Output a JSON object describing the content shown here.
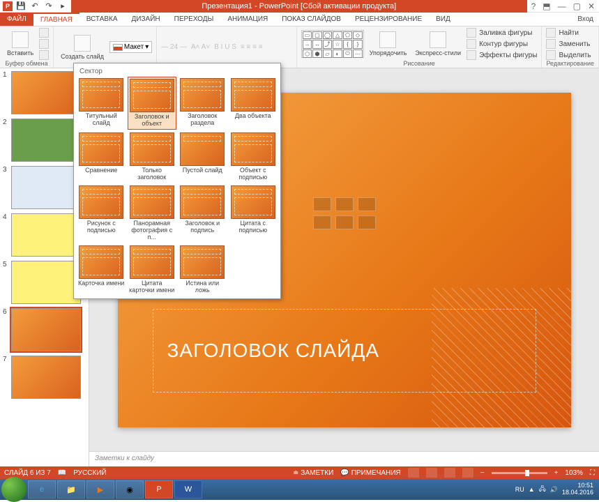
{
  "titlebar": {
    "title": "Презентация1 - PowerPoint [Сбой активации продукта]"
  },
  "tabs": {
    "file": "ФАЙЛ",
    "list": [
      "ГЛАВНАЯ",
      "ВСТАВКА",
      "ДИЗАЙН",
      "ПЕРЕХОДЫ",
      "АНИМАЦИЯ",
      "ПОКАЗ СЛАЙДОВ",
      "РЕЦЕНЗИРОВАНИЕ",
      "ВИД"
    ],
    "signin": "Вход"
  },
  "ribbon": {
    "clipboard_label": "Буфер обмена",
    "paste": "Вставить",
    "slides_label": "",
    "new_slide": "Создать слайд",
    "layout_btn": "Макет",
    "drawing_label": "Рисование",
    "arrange": "Упорядочить",
    "express": "Экспресс-стили",
    "shape_fill": "Заливка фигуры",
    "shape_outline": "Контур фигуры",
    "shape_effects": "Эффекты фигуры",
    "editing_label": "Редактирование",
    "find": "Найти",
    "replace": "Заменить",
    "select": "Выделить"
  },
  "layout_popup": {
    "header": "Сектор",
    "items": [
      "Титульный слайд",
      "Заголовок и объект",
      "Заголовок раздела",
      "Два объекта",
      "Сравнение",
      "Только заголовок",
      "Пустой слайд",
      "Объект с подписью",
      "Рисунок с подписью",
      "Панорамная фотография с п...",
      "Заголовок и подпись",
      "Цитата с подписью",
      "Карточка имени",
      "Цитата карточки имени",
      "Истина или ложь"
    ]
  },
  "slide": {
    "title_placeholder": "ЗАГОЛОВОК СЛАЙДА"
  },
  "notes": {
    "placeholder": "Заметки к слайду"
  },
  "statusbar": {
    "slide_info": "СЛАЙД 6 ИЗ 7",
    "lang": "РУССКИЙ",
    "notes_btn": "ЗАМЕТКИ",
    "comments_btn": "ПРИМЕЧАНИЯ",
    "zoom": "103%"
  },
  "taskbar": {
    "lang": "RU",
    "time": "10:51",
    "date": "18.04.2016"
  },
  "thumbs": [
    "1",
    "2",
    "3",
    "4",
    "5",
    "6",
    "7"
  ]
}
